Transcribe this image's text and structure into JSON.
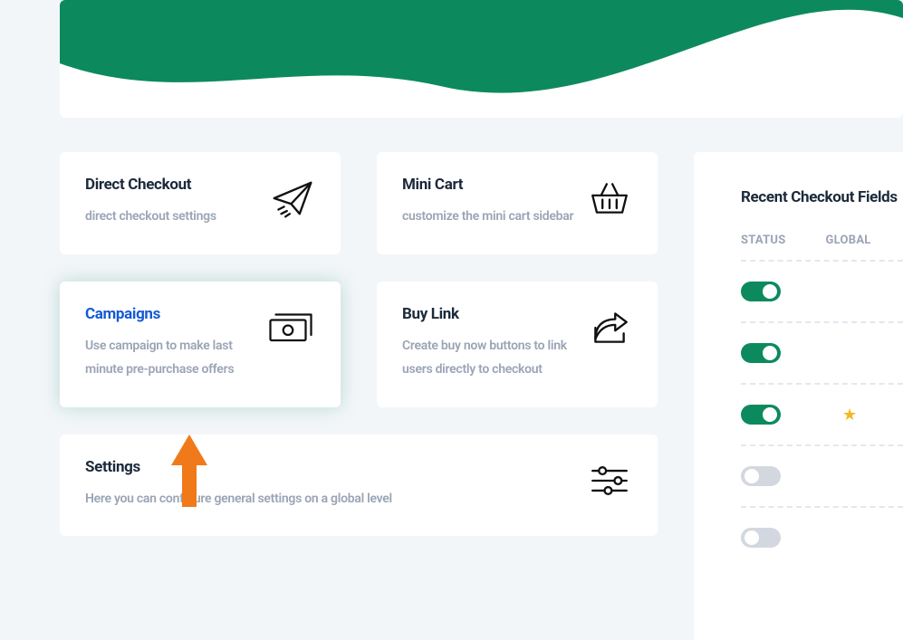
{
  "cards": {
    "direct_checkout": {
      "title": "Direct Checkout",
      "desc": "direct checkout settings"
    },
    "mini_cart": {
      "title": "Mini Cart",
      "desc": "customize the mini cart sidebar"
    },
    "campaigns": {
      "title": "Campaigns",
      "desc": "Use campaign to make last minute pre-purchase offers"
    },
    "buy_link": {
      "title": "Buy Link",
      "desc": "Create buy now buttons to link users directly to checkout"
    },
    "settings": {
      "title": "Settings",
      "desc": "Here you can configure general settings on a global level"
    }
  },
  "sidepanel": {
    "title": "Recent Checkout Fields",
    "columns": {
      "status": "STATUS",
      "global": "GLOBAL"
    },
    "rows": [
      {
        "status_on": true,
        "global_star": false
      },
      {
        "status_on": true,
        "global_star": false
      },
      {
        "status_on": true,
        "global_star": true
      },
      {
        "status_on": false,
        "global_star": false
      },
      {
        "status_on": false,
        "global_star": false
      }
    ]
  }
}
